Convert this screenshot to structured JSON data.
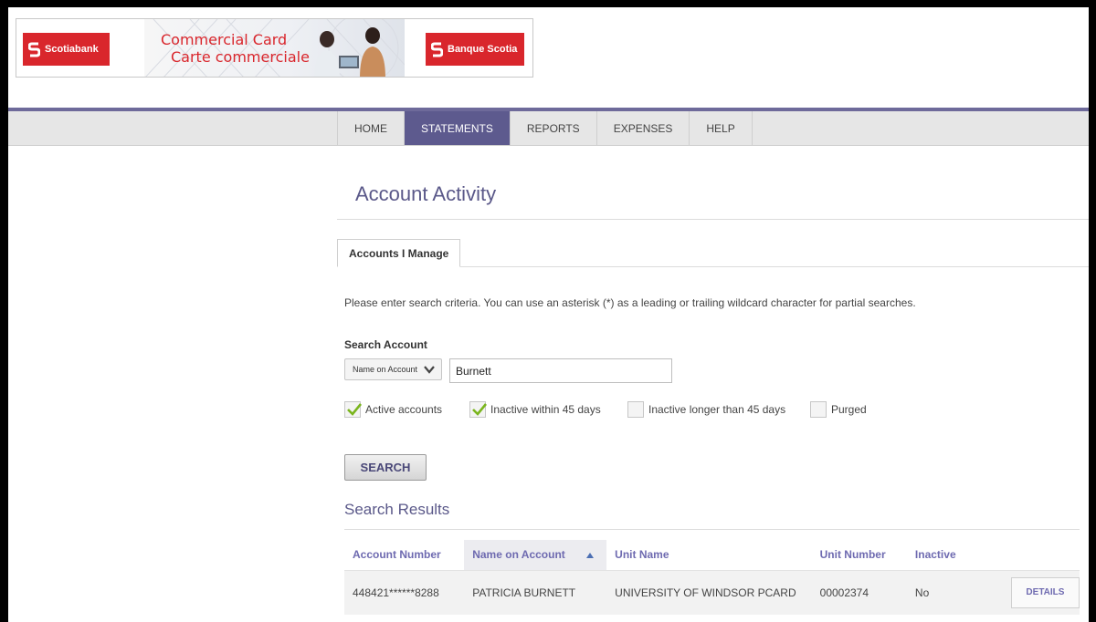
{
  "banner": {
    "brand_left": "Scotiabank",
    "brand_right": "Banque Scotia",
    "title_line1": "Commercial Card",
    "title_line2": "Carte commerciale"
  },
  "nav": {
    "tabs": [
      {
        "label": "HOME",
        "active": false
      },
      {
        "label": "STATEMENTS",
        "active": true
      },
      {
        "label": "REPORTS",
        "active": false
      },
      {
        "label": "EXPENSES",
        "active": false
      },
      {
        "label": "HELP",
        "active": false
      }
    ]
  },
  "page": {
    "title": "Account Activity",
    "subtab": "Accounts I Manage",
    "instructions": "Please enter search criteria. You can use an asterisk (*) as a leading or trailing wildcard character for partial searches."
  },
  "search": {
    "label": "Search Account",
    "type_selected": "Name on Account",
    "value": "Burnett",
    "filters": [
      {
        "label": "Active accounts",
        "checked": true
      },
      {
        "label": "Inactive within 45 days",
        "checked": true
      },
      {
        "label": "Inactive longer than 45 days",
        "checked": false
      },
      {
        "label": "Purged",
        "checked": false
      }
    ],
    "button_label": "SEARCH"
  },
  "results": {
    "title": "Search Results",
    "columns": [
      "Account Number",
      "Name on Account",
      "Unit Name",
      "Unit Number",
      "Inactive"
    ],
    "rows": [
      {
        "account_number": "448421******8288",
        "name": "PATRICIA BURNETT",
        "unit_name": "UNIVERSITY OF WINDSOR PCARD",
        "unit_number": "00002374",
        "inactive": "No",
        "action_label": "DETAILS"
      }
    ]
  },
  "colors": {
    "brand_red": "#d9262c",
    "nav_active": "#5d5a8e",
    "accent_text": "#6e6ab0",
    "check_green": "#7ab51d"
  },
  "icons": {
    "sort": "sort-ascending-icon",
    "dropdown": "chevron-down-icon",
    "check": "checkmark-icon"
  }
}
